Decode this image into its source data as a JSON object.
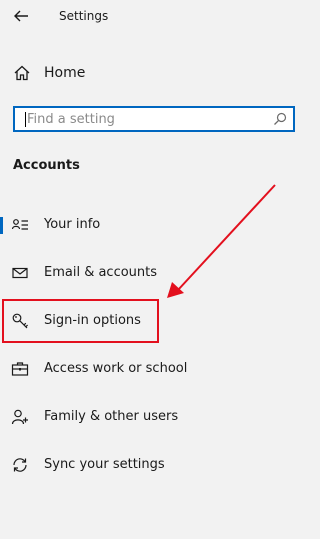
{
  "titlebar": {
    "back_icon": "back-arrow-icon",
    "title": "Settings"
  },
  "home": {
    "icon": "home-icon",
    "label": "Home"
  },
  "search": {
    "placeholder": "Find a setting",
    "value": "",
    "icon": "search-icon"
  },
  "section": {
    "heading": "Accounts"
  },
  "nav": {
    "items": [
      {
        "icon": "person-card-icon",
        "label": "Your info"
      },
      {
        "icon": "envelope-icon",
        "label": "Email & accounts"
      },
      {
        "icon": "key-icon",
        "label": "Sign-in options"
      },
      {
        "icon": "briefcase-icon",
        "label": "Access work or school"
      },
      {
        "icon": "person-add-icon",
        "label": "Family & other users"
      },
      {
        "icon": "sync-icon",
        "label": "Sync your settings"
      }
    ]
  },
  "annotation": {
    "color": "#e3101e",
    "highlighted_item": "Sign-in options"
  },
  "colors": {
    "background": "#f2f2f2",
    "accent": "#0067c0",
    "text": "#1a1a1a"
  }
}
